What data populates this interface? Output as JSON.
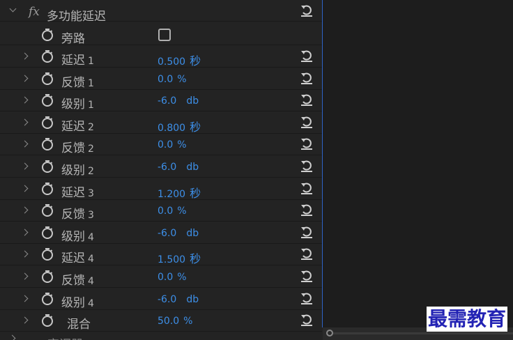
{
  "effect": {
    "fx_label": "fx",
    "title": "多功能延迟",
    "bypass_label": "旁路",
    "bypass_checked": false
  },
  "params": [
    {
      "label": "延迟",
      "num": "1",
      "value": "0.500",
      "unit": "秒"
    },
    {
      "label": "反馈",
      "num": "1",
      "value": "0.0",
      "unit": "%"
    },
    {
      "label": "级别",
      "num": "1",
      "value": "-6.0",
      "unit": "db"
    },
    {
      "label": "延迟",
      "num": "2",
      "value": "0.800",
      "unit": "秒"
    },
    {
      "label": "反馈",
      "num": "2",
      "value": "0.0",
      "unit": "%"
    },
    {
      "label": "级别",
      "num": "2",
      "value": "-6.0",
      "unit": "db"
    },
    {
      "label": "延迟",
      "num": "3",
      "value": "1.200",
      "unit": "秒"
    },
    {
      "label": "反馈",
      "num": "3",
      "value": "0.0",
      "unit": "%"
    },
    {
      "label": "级别",
      "num": "4",
      "value": "-6.0",
      "unit": "db"
    },
    {
      "label": "延迟",
      "num": "4",
      "value": "1.500",
      "unit": "秒"
    },
    {
      "label": "反馈",
      "num": "4",
      "value": "0.0",
      "unit": "%"
    },
    {
      "label": "级别",
      "num": "4",
      "value": "-6.0",
      "unit": "db"
    },
    {
      "label": "混合",
      "num": "",
      "value": "50.0",
      "unit": "%"
    }
  ],
  "next_effect": {
    "label": "变调器"
  },
  "watermark": "最需教育",
  "colors": {
    "value_blue": "#3d8fe8",
    "playhead": "#2e63c8"
  }
}
